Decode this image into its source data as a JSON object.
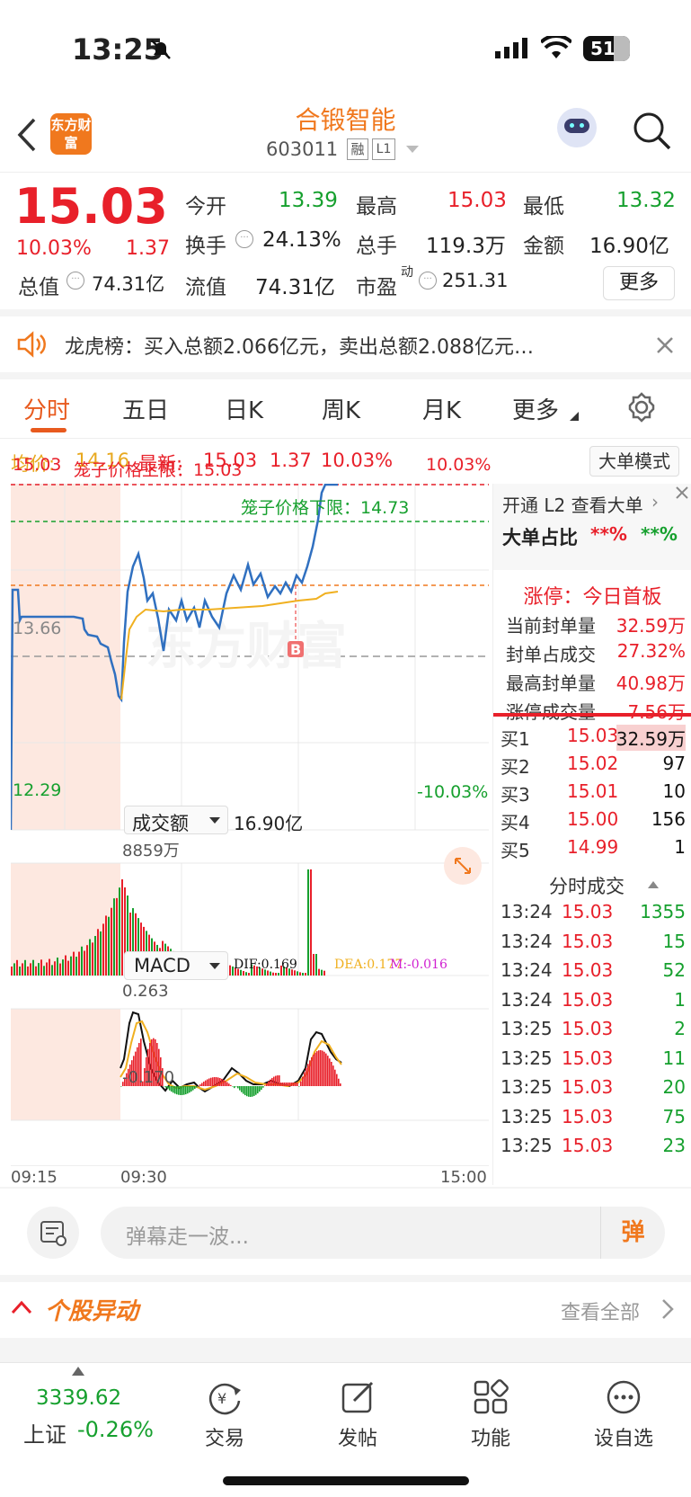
{
  "status": {
    "time": "13:25",
    "battery": "51"
  },
  "header": {
    "logo": "东方财富",
    "name": "合锻智能",
    "code": "603011",
    "tag1": "融",
    "tag2": "L1"
  },
  "quote": {
    "price": "15.03",
    "pct": "10.03%",
    "chg": "1.37",
    "open_l": "今开",
    "open": "13.39",
    "high_l": "最高",
    "high": "15.03",
    "low_l": "最低",
    "low": "13.32",
    "turn_l": "换手",
    "turn": "24.13%",
    "vol_l": "总手",
    "vol": "119.3万",
    "amt_l": "金额",
    "amt": "16.90亿",
    "mcap_l": "总值",
    "mcap": "74.31亿",
    "fcap_l": "流值",
    "fcap": "74.31亿",
    "pe_l": "市盈",
    "pe_sup": "动",
    "pe": "251.31",
    "more": "更多"
  },
  "notice": {
    "text": "龙虎榜：买入总额2.066亿元，卖出总额2.088亿元…"
  },
  "tabs": [
    "分时",
    "五日",
    "日K",
    "周K",
    "月K",
    "更多"
  ],
  "info": {
    "avg_l": "均价:",
    "avg": "14.16",
    "last_l": "最新:",
    "last": "15.03",
    "chg": "1.37",
    "pct": "10.03%",
    "mode": "大单模式"
  },
  "chart": {
    "top_price": "15.03",
    "top_pct": "10.03%",
    "bottom_price": "12.29",
    "bottom_pct": "-10.03%",
    "mid": "13.66",
    "upper_limit": "笼子价格上限：15.03",
    "lower_limit": "笼子价格下限：14.73",
    "b_mark": "B",
    "watermark": "东方财富",
    "vol_sel": "成交额",
    "vol_total": "16.90亿",
    "vol_max": "8859万",
    "macd_sel": "MACD",
    "dif": "DIF:0.169",
    "dea": "DEA:0.177",
    "m": "M:-0.016",
    "macd_top": "0.263",
    "macd_bot": "-0.170",
    "t1": "09:15",
    "t2": "09:30",
    "t3": "15:00"
  },
  "side": {
    "l2": "开通 L2 查看大单",
    "big_l": "大单占比",
    "big1": "**%",
    "big2": "**%",
    "limit_title": "涨停：今日首板",
    "rows": [
      {
        "l": "当前封单量",
        "v": "32.59万"
      },
      {
        "l": "封单占成交",
        "v": "27.32%"
      },
      {
        "l": "最高封单量",
        "v": "40.98万"
      },
      {
        "l": "涨停成交量",
        "v": "7.56万"
      }
    ],
    "book": [
      {
        "l": "买1",
        "p": "15.03",
        "v": "32.59万"
      },
      {
        "l": "买2",
        "p": "15.02",
        "v": "97"
      },
      {
        "l": "买3",
        "p": "15.01",
        "v": "10"
      },
      {
        "l": "买4",
        "p": "15.00",
        "v": "156"
      },
      {
        "l": "买5",
        "p": "14.99",
        "v": "1"
      }
    ],
    "ticks_title": "分时成交",
    "ticks": [
      {
        "t": "13:24",
        "p": "15.03",
        "v": "1355"
      },
      {
        "t": "13:24",
        "p": "15.03",
        "v": "15"
      },
      {
        "t": "13:24",
        "p": "15.03",
        "v": "52"
      },
      {
        "t": "13:24",
        "p": "15.03",
        "v": "1"
      },
      {
        "t": "13:25",
        "p": "15.03",
        "v": "2"
      },
      {
        "t": "13:25",
        "p": "15.03",
        "v": "11"
      },
      {
        "t": "13:25",
        "p": "15.03",
        "v": "20"
      },
      {
        "t": "13:25",
        "p": "15.03",
        "v": "75"
      },
      {
        "t": "13:25",
        "p": "15.03",
        "v": "23"
      }
    ]
  },
  "comment": {
    "placeholder": "弹幕走一波...",
    "btn": "弹"
  },
  "section": {
    "title": "个股异动",
    "link": "查看全部"
  },
  "nav": {
    "index_val": "3339.62",
    "index_name": "上证",
    "index_pct": "-0.26%",
    "items": [
      "交易",
      "发帖",
      "功能",
      "设自选"
    ]
  }
}
